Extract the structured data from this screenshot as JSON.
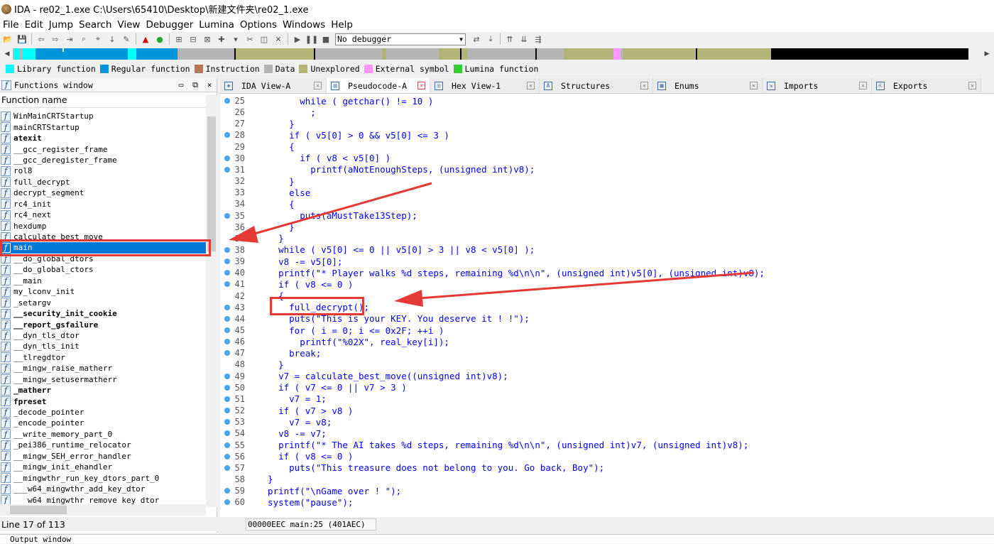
{
  "window": {
    "title": "IDA - re02_1.exe C:\\Users\\65410\\Desktop\\新建文件夹\\re02_1.exe"
  },
  "menu": [
    "File",
    "Edit",
    "Jump",
    "Search",
    "View",
    "Debugger",
    "Lumina",
    "Options",
    "Windows",
    "Help"
  ],
  "toolbar": {
    "debugger_select": "No debugger"
  },
  "legend": [
    {
      "label": "Library function",
      "color": "#00ffff"
    },
    {
      "label": "Regular function",
      "color": "#0095da"
    },
    {
      "label": "Instruction",
      "color": "#b8785a"
    },
    {
      "label": "Data",
      "color": "#b4b4b4"
    },
    {
      "label": "Unexplored",
      "color": "#b4b478"
    },
    {
      "label": "External symbol",
      "color": "#ff99ff"
    },
    {
      "label": "Lumina function",
      "color": "#33cc33"
    }
  ],
  "functions_window": {
    "title": "Functions window",
    "column": "Function name",
    "items": [
      {
        "name": "WinMainCRTStartup",
        "bold": false
      },
      {
        "name": "mainCRTStartup",
        "bold": false
      },
      {
        "name": "atexit",
        "bold": true
      },
      {
        "name": "__gcc_register_frame",
        "bold": false
      },
      {
        "name": "__gcc_deregister_frame",
        "bold": false
      },
      {
        "name": "rol8",
        "bold": false
      },
      {
        "name": "full_decrypt",
        "bold": false
      },
      {
        "name": "decrypt_segment",
        "bold": false
      },
      {
        "name": "rc4_init",
        "bold": false
      },
      {
        "name": "rc4_next",
        "bold": false
      },
      {
        "name": "hexdump",
        "bold": false
      },
      {
        "name": "calculate_best_move",
        "bold": false
      },
      {
        "name": "main",
        "bold": false,
        "selected": true
      },
      {
        "name": "__do_global_dtors",
        "bold": false
      },
      {
        "name": "__do_global_ctors",
        "bold": false
      },
      {
        "name": "__main",
        "bold": false
      },
      {
        "name": "my_lconv_init",
        "bold": false
      },
      {
        "name": "_setargv",
        "bold": false
      },
      {
        "name": "__security_init_cookie",
        "bold": true
      },
      {
        "name": "__report_gsfailure",
        "bold": true
      },
      {
        "name": "__dyn_tls_dtor",
        "bold": false
      },
      {
        "name": "__dyn_tls_init",
        "bold": false
      },
      {
        "name": "__tlregdtor",
        "bold": false
      },
      {
        "name": "__mingw_raise_matherr",
        "bold": false
      },
      {
        "name": "__mingw_setusermatherr",
        "bold": false
      },
      {
        "name": "_matherr",
        "bold": true
      },
      {
        "name": "fpreset",
        "bold": true
      },
      {
        "name": "_decode_pointer",
        "bold": false
      },
      {
        "name": "_encode_pointer",
        "bold": false
      },
      {
        "name": "__write_memory_part_0",
        "bold": false
      },
      {
        "name": "_pei386_runtime_relocator",
        "bold": false
      },
      {
        "name": "__mingw_SEH_error_handler",
        "bold": false
      },
      {
        "name": "__mingw_init_ehandler",
        "bold": false
      },
      {
        "name": "__mingwthr_run_key_dtors_part_0",
        "bold": false
      },
      {
        "name": "___w64_mingwthr_add_key_dtor",
        "bold": false
      },
      {
        "name": "___w64_mingwthr_remove_key_dtor",
        "bold": false
      }
    ],
    "status": "Line 17 of 113"
  },
  "tabs": [
    {
      "label": "IDA View-A",
      "active": false,
      "icon": "ida-view-icon"
    },
    {
      "label": "Pseudocode-A",
      "active": true,
      "icon": "pseudocode-icon"
    },
    {
      "label": "Hex View-1",
      "active": false,
      "icon": "hex-icon"
    },
    {
      "label": "Structures",
      "active": false,
      "icon": "structures-icon"
    },
    {
      "label": "Enums",
      "active": false,
      "icon": "enums-icon"
    },
    {
      "label": "Imports",
      "active": false,
      "icon": "imports-icon"
    },
    {
      "label": "Exports",
      "active": false,
      "icon": "exports-icon"
    }
  ],
  "code": [
    {
      "n": "25",
      "dot": true,
      "t": "        while ( getchar() != 10 )"
    },
    {
      "n": "26",
      "dot": false,
      "t": "          ;"
    },
    {
      "n": "27",
      "dot": false,
      "t": "      }"
    },
    {
      "n": "28",
      "dot": true,
      "t": "      if ( v5[0] > 0 && v5[0] <= 3 )"
    },
    {
      "n": "29",
      "dot": false,
      "t": "      {"
    },
    {
      "n": "30",
      "dot": true,
      "t": "        if ( v8 < v5[0] )"
    },
    {
      "n": "31",
      "dot": true,
      "t": "          printf(aNotEnoughSteps, (unsigned int)v8);"
    },
    {
      "n": "32",
      "dot": false,
      "t": "      }"
    },
    {
      "n": "33",
      "dot": false,
      "t": "      else"
    },
    {
      "n": "34",
      "dot": false,
      "t": "      {"
    },
    {
      "n": "35",
      "dot": true,
      "t": "        puts(aMustTake13Step);"
    },
    {
      "n": "36",
      "dot": false,
      "t": "      }"
    },
    {
      "n": "37",
      "dot": false,
      "t": "    }"
    },
    {
      "n": "38",
      "dot": true,
      "t": "    while ( v5[0] <= 0 || v5[0] > 3 || v8 < v5[0] );"
    },
    {
      "n": "39",
      "dot": true,
      "t": "    v8 -= v5[0];"
    },
    {
      "n": "40",
      "dot": true,
      "t": "    printf(\"* Player walks %d steps, remaining %d\\n\\n\", (unsigned int)v5[0], (unsigned int)v8);"
    },
    {
      "n": "41",
      "dot": true,
      "t": "    if ( v8 <= 0 )"
    },
    {
      "n": "42",
      "dot": false,
      "t": "    {"
    },
    {
      "n": "43",
      "dot": true,
      "t": "      full_decrypt();"
    },
    {
      "n": "44",
      "dot": true,
      "t": "      puts(\"This is your KEY. You deserve it ! !\");"
    },
    {
      "n": "45",
      "dot": true,
      "t": "      for ( i = 0; i <= 0x2F; ++i )"
    },
    {
      "n": "46",
      "dot": true,
      "t": "        printf(\"%02X\", real_key[i]);"
    },
    {
      "n": "47",
      "dot": true,
      "t": "      break;"
    },
    {
      "n": "48",
      "dot": false,
      "t": "    }"
    },
    {
      "n": "49",
      "dot": true,
      "t": "    v7 = calculate_best_move((unsigned int)v8);"
    },
    {
      "n": "50",
      "dot": true,
      "t": "    if ( v7 <= 0 || v7 > 3 )"
    },
    {
      "n": "51",
      "dot": true,
      "t": "      v7 = 1;"
    },
    {
      "n": "52",
      "dot": true,
      "t": "    if ( v7 > v8 )"
    },
    {
      "n": "53",
      "dot": true,
      "t": "      v7 = v8;"
    },
    {
      "n": "54",
      "dot": true,
      "t": "    v8 -= v7;"
    },
    {
      "n": "55",
      "dot": true,
      "t": "    printf(\"* The AI takes %d steps, remaining %d\\n\\n\", (unsigned int)v7, (unsigned int)v8);"
    },
    {
      "n": "56",
      "dot": true,
      "t": "    if ( v8 <= 0 )"
    },
    {
      "n": "57",
      "dot": true,
      "t": "      puts(\"This treasure does not belong to you. Go back, Boy\");"
    },
    {
      "n": "58",
      "dot": false,
      "t": "  }"
    },
    {
      "n": "59",
      "dot": true,
      "t": "  printf(\"\\nGame over ! \");"
    },
    {
      "n": "60",
      "dot": true,
      "t": "  system(\"pause\");"
    }
  ],
  "code_status": "00000EEC main:25 (401AEC)",
  "output_window": "Output window",
  "colors": {
    "annotation": "#e53935",
    "code_text": "#0000ff",
    "selection": "#0078d7"
  }
}
